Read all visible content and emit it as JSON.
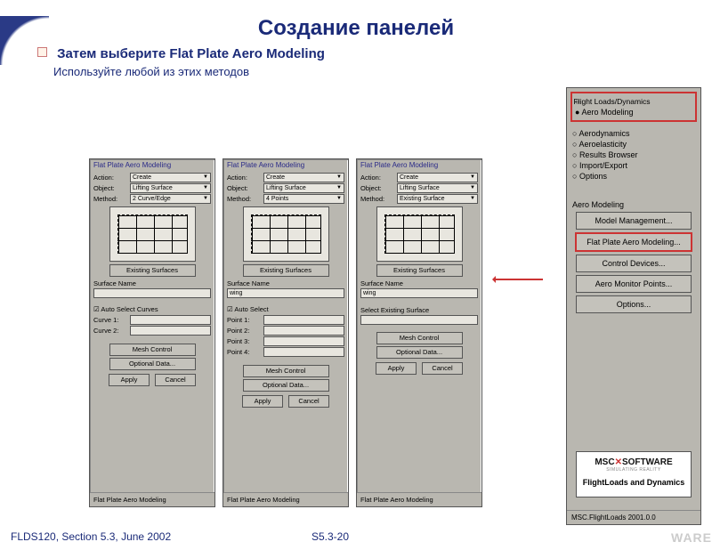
{
  "slide": {
    "title": "Создание панелей",
    "bullet": "Затем выберите Flat Plate Aero Modeling",
    "subbullet": "Используйте любой из этих методов",
    "footer_left": "FLDS120, Section 5.3, June 2002",
    "footer_mid": "S5.3-20",
    "brand": "WARE"
  },
  "panelA": {
    "title": "Flat Plate Aero Modeling",
    "action_label": "Action:",
    "action_val": "Create",
    "object_label": "Object:",
    "object_val": "Lifting Surface",
    "method_label": "Method:",
    "method_val": "2 Curve/Edge",
    "existing_btn": "Existing Surfaces",
    "surf_label": "Surface Name",
    "surf_val": "",
    "check": "Auto Select Curves",
    "c1": "Curve 1:",
    "c2": "Curve 2:",
    "mesh_btn": "Mesh Control",
    "opt_btn": "Optional Data...",
    "apply": "Apply",
    "cancel": "Cancel",
    "footer": "Flat Plate Aero Modeling"
  },
  "panelB": {
    "title": "Flat Plate Aero Modeling",
    "action_val": "Create",
    "object_val": "Lifting Surface",
    "method_val": "4 Points",
    "existing_btn": "Existing Surfaces",
    "surf_label": "Surface Name",
    "surf_val": "wing",
    "check": "Auto Select",
    "p1": "Point 1:",
    "p2": "Point 2:",
    "p3": "Point 3:",
    "p4": "Point 4:",
    "mesh_btn": "Mesh Control",
    "opt_btn": "Optional Data...",
    "apply": "Apply",
    "cancel": "Cancel",
    "footer": "Flat Plate Aero Modeling"
  },
  "panelC": {
    "title": "Flat Plate Aero Modeling",
    "action_val": "Create",
    "object_val": "Lifting Surface",
    "method_val": "Existing Surface",
    "existing_btn": "Existing Surfaces",
    "surf_label": "Surface Name",
    "surf_val": "wing",
    "sel_label": "Select Existing Surface",
    "mesh_btn": "Mesh Control",
    "opt_btn": "Optional Data...",
    "apply": "Apply",
    "cancel": "Cancel",
    "footer": "Flat Plate Aero Modeling"
  },
  "sidebar": {
    "group_title": "Flight Loads/Dynamics",
    "radios": [
      "Aero Modeling",
      "Aerodynamics",
      "Aeroelasticity",
      "Results Browser",
      "Import/Export",
      "Options"
    ],
    "selected_index": 0,
    "section_label": "Aero Modeling",
    "buttons": [
      "Model Management...",
      "Flat Plate Aero Modeling...",
      "Control Devices...",
      "Aero Monitor Points...",
      "Options..."
    ],
    "highlight_index": 1,
    "logo_top": "MSC",
    "logo_top2": "SOFTWARE",
    "logo_sub": "SIMULATING REALITY",
    "logo_bottom": "FlightLoads and Dynamics",
    "footer": "MSC.FlightLoads 2001.0.0"
  }
}
